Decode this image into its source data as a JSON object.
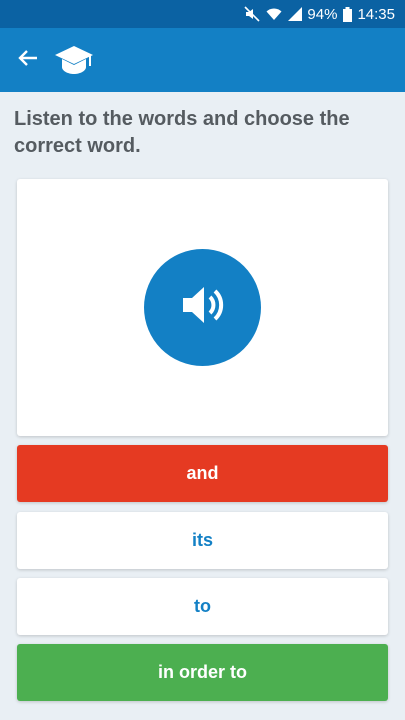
{
  "status_bar": {
    "battery": "94%",
    "time": "14:35",
    "icons": [
      "mute-icon",
      "wifi-icon",
      "signal-icon",
      "battery-icon"
    ]
  },
  "app_bar": {
    "color": "#1380c5",
    "icons": [
      "back-arrow-icon",
      "graduation-cap-icon"
    ]
  },
  "instruction": "Listen to the words and choose the correct word.",
  "audio_card": {
    "icon": "speaker-icon",
    "button_color": "#1380c5"
  },
  "options": [
    {
      "label": "and",
      "state": "wrong",
      "color": "#e53a22"
    },
    {
      "label": "its",
      "state": "neutral"
    },
    {
      "label": "to",
      "state": "neutral"
    },
    {
      "label": "in order to",
      "state": "correct",
      "color": "#4caf50"
    }
  ]
}
